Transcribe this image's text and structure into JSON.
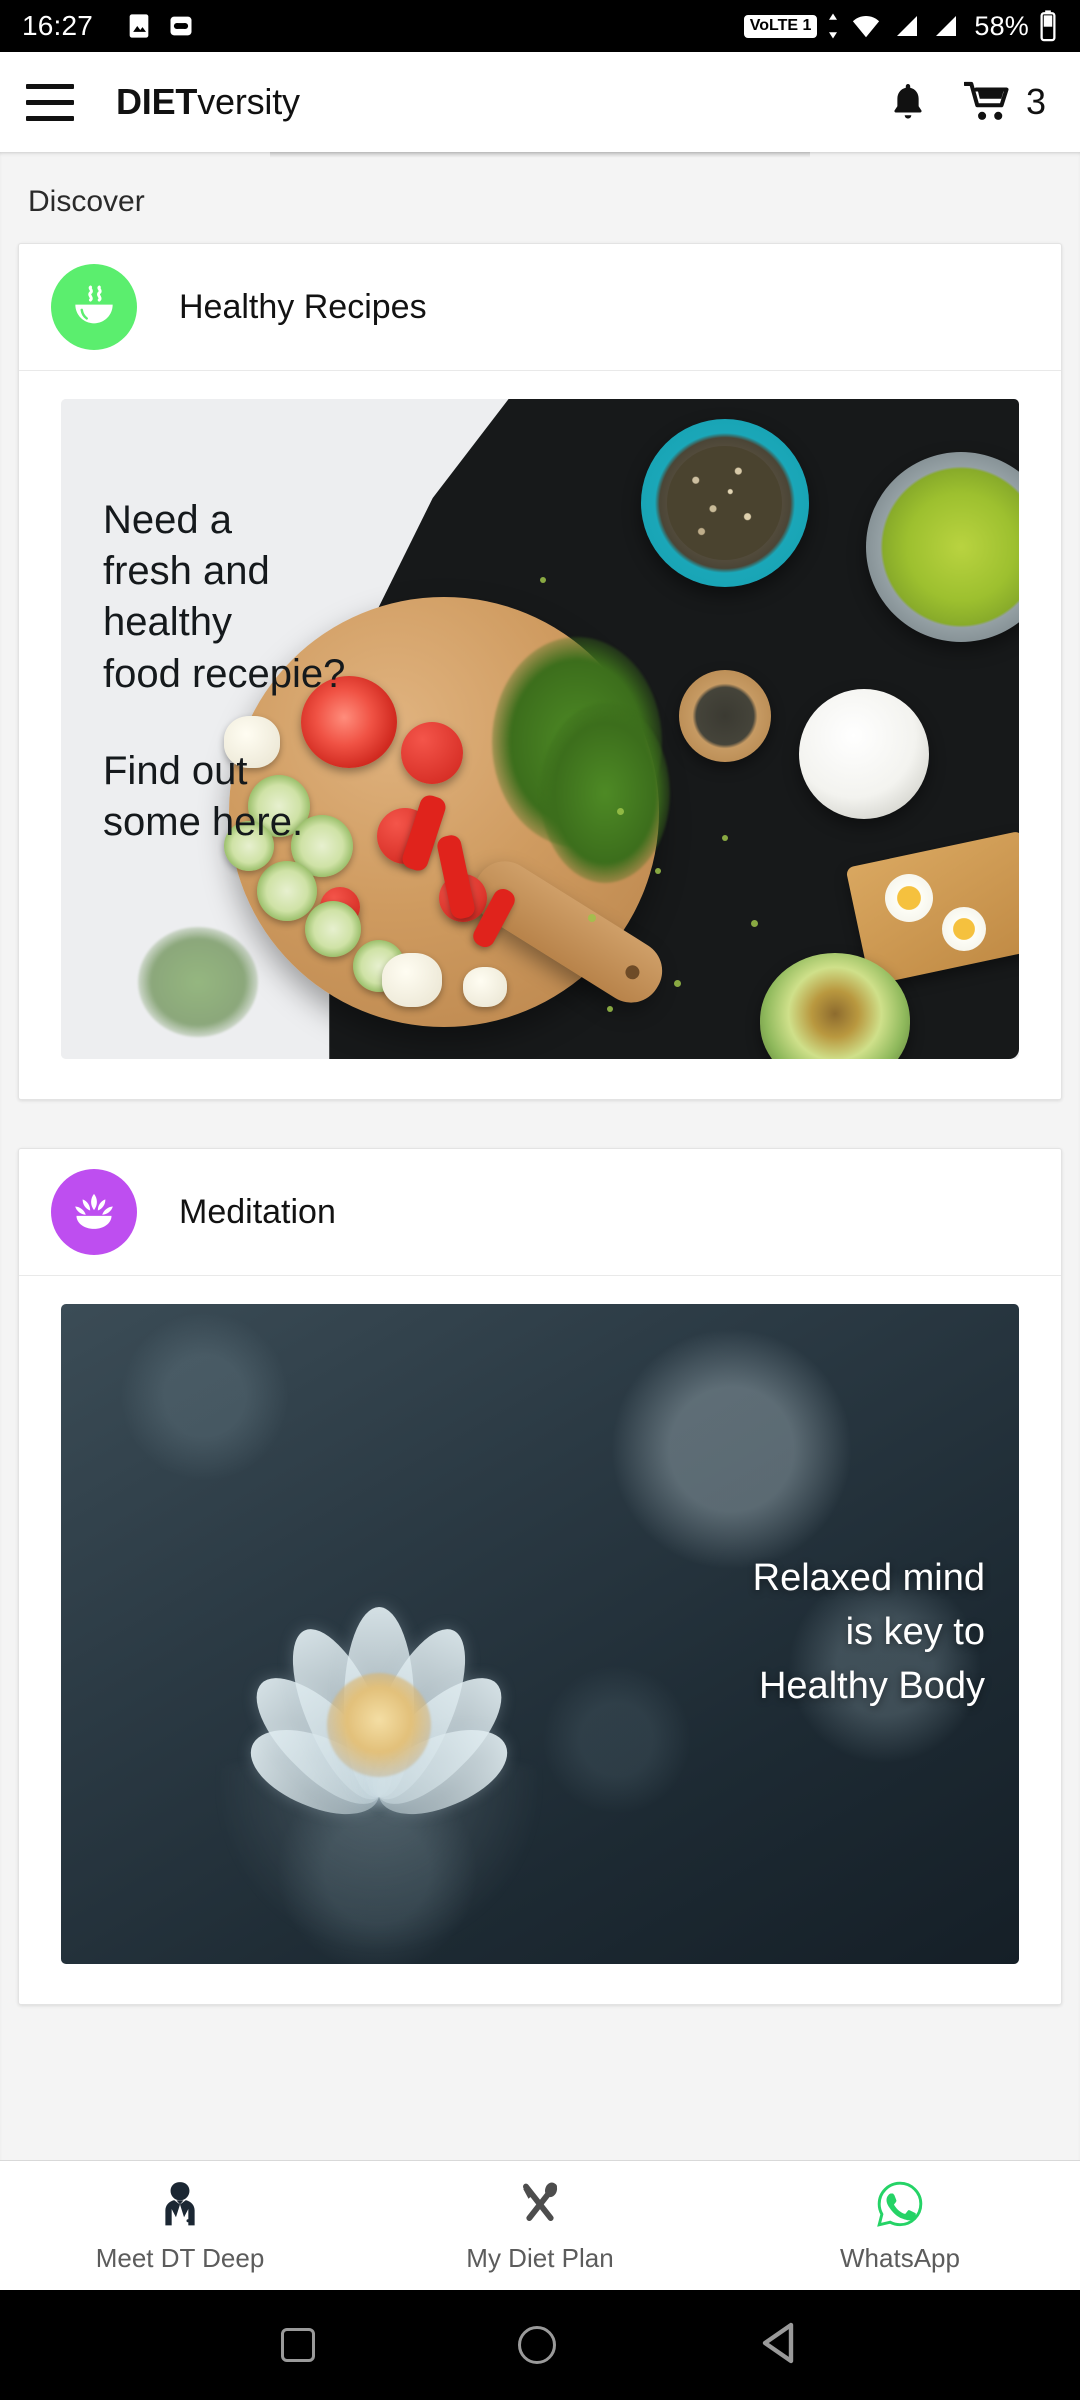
{
  "status_bar": {
    "time": "16:27",
    "icons": [
      "image-icon",
      "voicemail-icon"
    ],
    "network_badge": "VoLTE 1",
    "wifi": "wifi-icon",
    "signal_1": "signal-icon",
    "signal_2": "signal-icon",
    "battery_percent": "58%"
  },
  "app_bar": {
    "menu_icon": "hamburger-menu-icon",
    "title_bold": "DIET",
    "title_rest": "versity",
    "notification_icon": "bell-icon",
    "cart_icon": "cart-icon",
    "cart_count": "3"
  },
  "section": {
    "label": "Discover"
  },
  "cards": [
    {
      "id": "healthy-recipes",
      "title": "Healthy Recipes",
      "icon": "bowl-steam-icon",
      "icon_bg": "#5BEE6E",
      "banner_lines": [
        "Need a",
        "fresh and",
        "healthy",
        "food recepie?",
        "Find out",
        "some here."
      ],
      "banner_paragraph_1": "Need a\nfresh and\nhealthy\nfood recepie?",
      "banner_paragraph_2": "Find out\nsome here.",
      "banner_bg": "#EDEEF0"
    },
    {
      "id": "meditation",
      "title": "Meditation",
      "icon": "lotus-icon",
      "icon_bg": "#BE4EF0",
      "banner_text": "Relaxed mind\nis key to\nHealthy Body",
      "banner_bg": "#1D2A33"
    }
  ],
  "bottom_nav": [
    {
      "id": "meet-dt-deep",
      "label": "Meet DT Deep",
      "icon": "dietitian-icon",
      "color": "#1b2733"
    },
    {
      "id": "my-diet-plan",
      "label": "My Diet Plan",
      "icon": "cutlery-icon",
      "color": "#4d4d4d"
    },
    {
      "id": "whatsapp",
      "label": "WhatsApp",
      "icon": "whatsapp-icon",
      "color": "#25D366"
    }
  ],
  "android_nav": {
    "recents": "square-icon",
    "home": "circle-icon",
    "back": "triangle-back-icon"
  }
}
